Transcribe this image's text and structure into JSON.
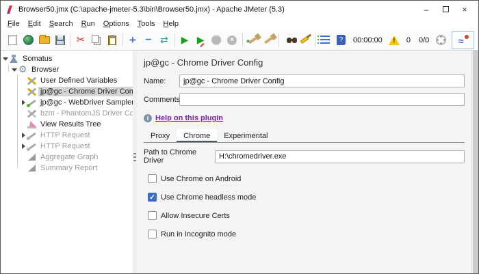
{
  "window": {
    "title": "Browser50.jmx (C:\\apache-jmeter-5.3\\bin\\Browser50.jmx) - Apache JMeter (5.3)",
    "controls": {
      "minimize": "–",
      "close": "×"
    }
  },
  "menu": {
    "items": [
      {
        "first": "F",
        "rest": "ile"
      },
      {
        "first": "E",
        "rest": "dit"
      },
      {
        "first": "S",
        "rest": "earch"
      },
      {
        "first": "R",
        "rest": "un"
      },
      {
        "first": "O",
        "rest": "ptions"
      },
      {
        "first": "T",
        "rest": "ools"
      },
      {
        "first": "H",
        "rest": "elp"
      }
    ]
  },
  "toolbar": {
    "icons": [
      "new-file-icon",
      "templates-icon",
      "open-file-icon",
      "save-icon",
      "cut-icon",
      "copy-icon",
      "paste-icon",
      "add-icon",
      "remove-icon",
      "undo-redo-icon",
      "start-icon",
      "start-no-pauses-icon",
      "stop-icon",
      "shutdown-icon",
      "clear-icon",
      "clear-all-icon",
      "search-icon",
      "search-reset-icon",
      "function-helper-icon",
      "help-icon",
      "warning-icon",
      "threads-icon",
      "plugins-manager-icon"
    ],
    "timer": "00:00:00",
    "warning_count": "0",
    "thread_count": "0/0"
  },
  "tree": {
    "items": [
      {
        "label": "Somatus",
        "icon": "test-plan",
        "expander": "expanded",
        "level": 0,
        "enabled": true
      },
      {
        "label": "Browser",
        "icon": "thread-group",
        "expander": "expanded",
        "level": 1,
        "enabled": true
      },
      {
        "label": "User Defined Variables",
        "icon": "config-tools",
        "level": 2,
        "enabled": true
      },
      {
        "label": "jp@gc - Chrome Driver Config",
        "icon": "config-tools",
        "level": 2,
        "enabled": true,
        "selected": true
      },
      {
        "label": "jp@gc - WebDriver Sampler",
        "icon": "sampler-dropper",
        "expander": "collapsed",
        "level": 2,
        "enabled": true
      },
      {
        "label": "bzm - PhantomJS Driver Config",
        "icon": "config-tools",
        "level": 2,
        "enabled": false
      },
      {
        "label": "View Results Tree",
        "icon": "results-tree-chart",
        "level": 2,
        "enabled": true
      },
      {
        "label": "HTTP Request",
        "icon": "sampler-dropper",
        "expander": "collapsed",
        "level": 2,
        "enabled": false
      },
      {
        "label": "HTTP Request",
        "icon": "sampler-dropper",
        "expander": "collapsed",
        "level": 2,
        "enabled": false
      },
      {
        "label": "Aggregate Graph",
        "icon": "report-chart",
        "level": 2,
        "enabled": false
      },
      {
        "label": "Summary Report",
        "icon": "report-chart",
        "level": 2,
        "enabled": false
      }
    ]
  },
  "main": {
    "title": "jp@gc - Chrome Driver Config",
    "name_label": "Name:",
    "name_value": "jp@gc - Chrome Driver Config",
    "comments_label": "Comments:",
    "comments_value": "",
    "help_link": "Help on this plugin",
    "tabs": [
      {
        "label": "Proxy",
        "selected": false
      },
      {
        "label": "Chrome",
        "selected": true
      },
      {
        "label": "Experimental",
        "selected": false
      }
    ],
    "path_label": "Path to Chrome Driver",
    "path_value": "H:\\chromedriver.exe",
    "checkboxes": [
      {
        "label": "Use Chrome on Android",
        "checked": false
      },
      {
        "label": "Use Chrome headless mode",
        "checked": true
      },
      {
        "label": "Allow Insecure Certs",
        "checked": false
      },
      {
        "label": "Run in Incognito mode",
        "checked": false
      }
    ],
    "colors": {
      "checked_blue": "#3d6cc8",
      "tab_accent": "#3a5a8c",
      "link_purple": "#7a22aa"
    }
  }
}
